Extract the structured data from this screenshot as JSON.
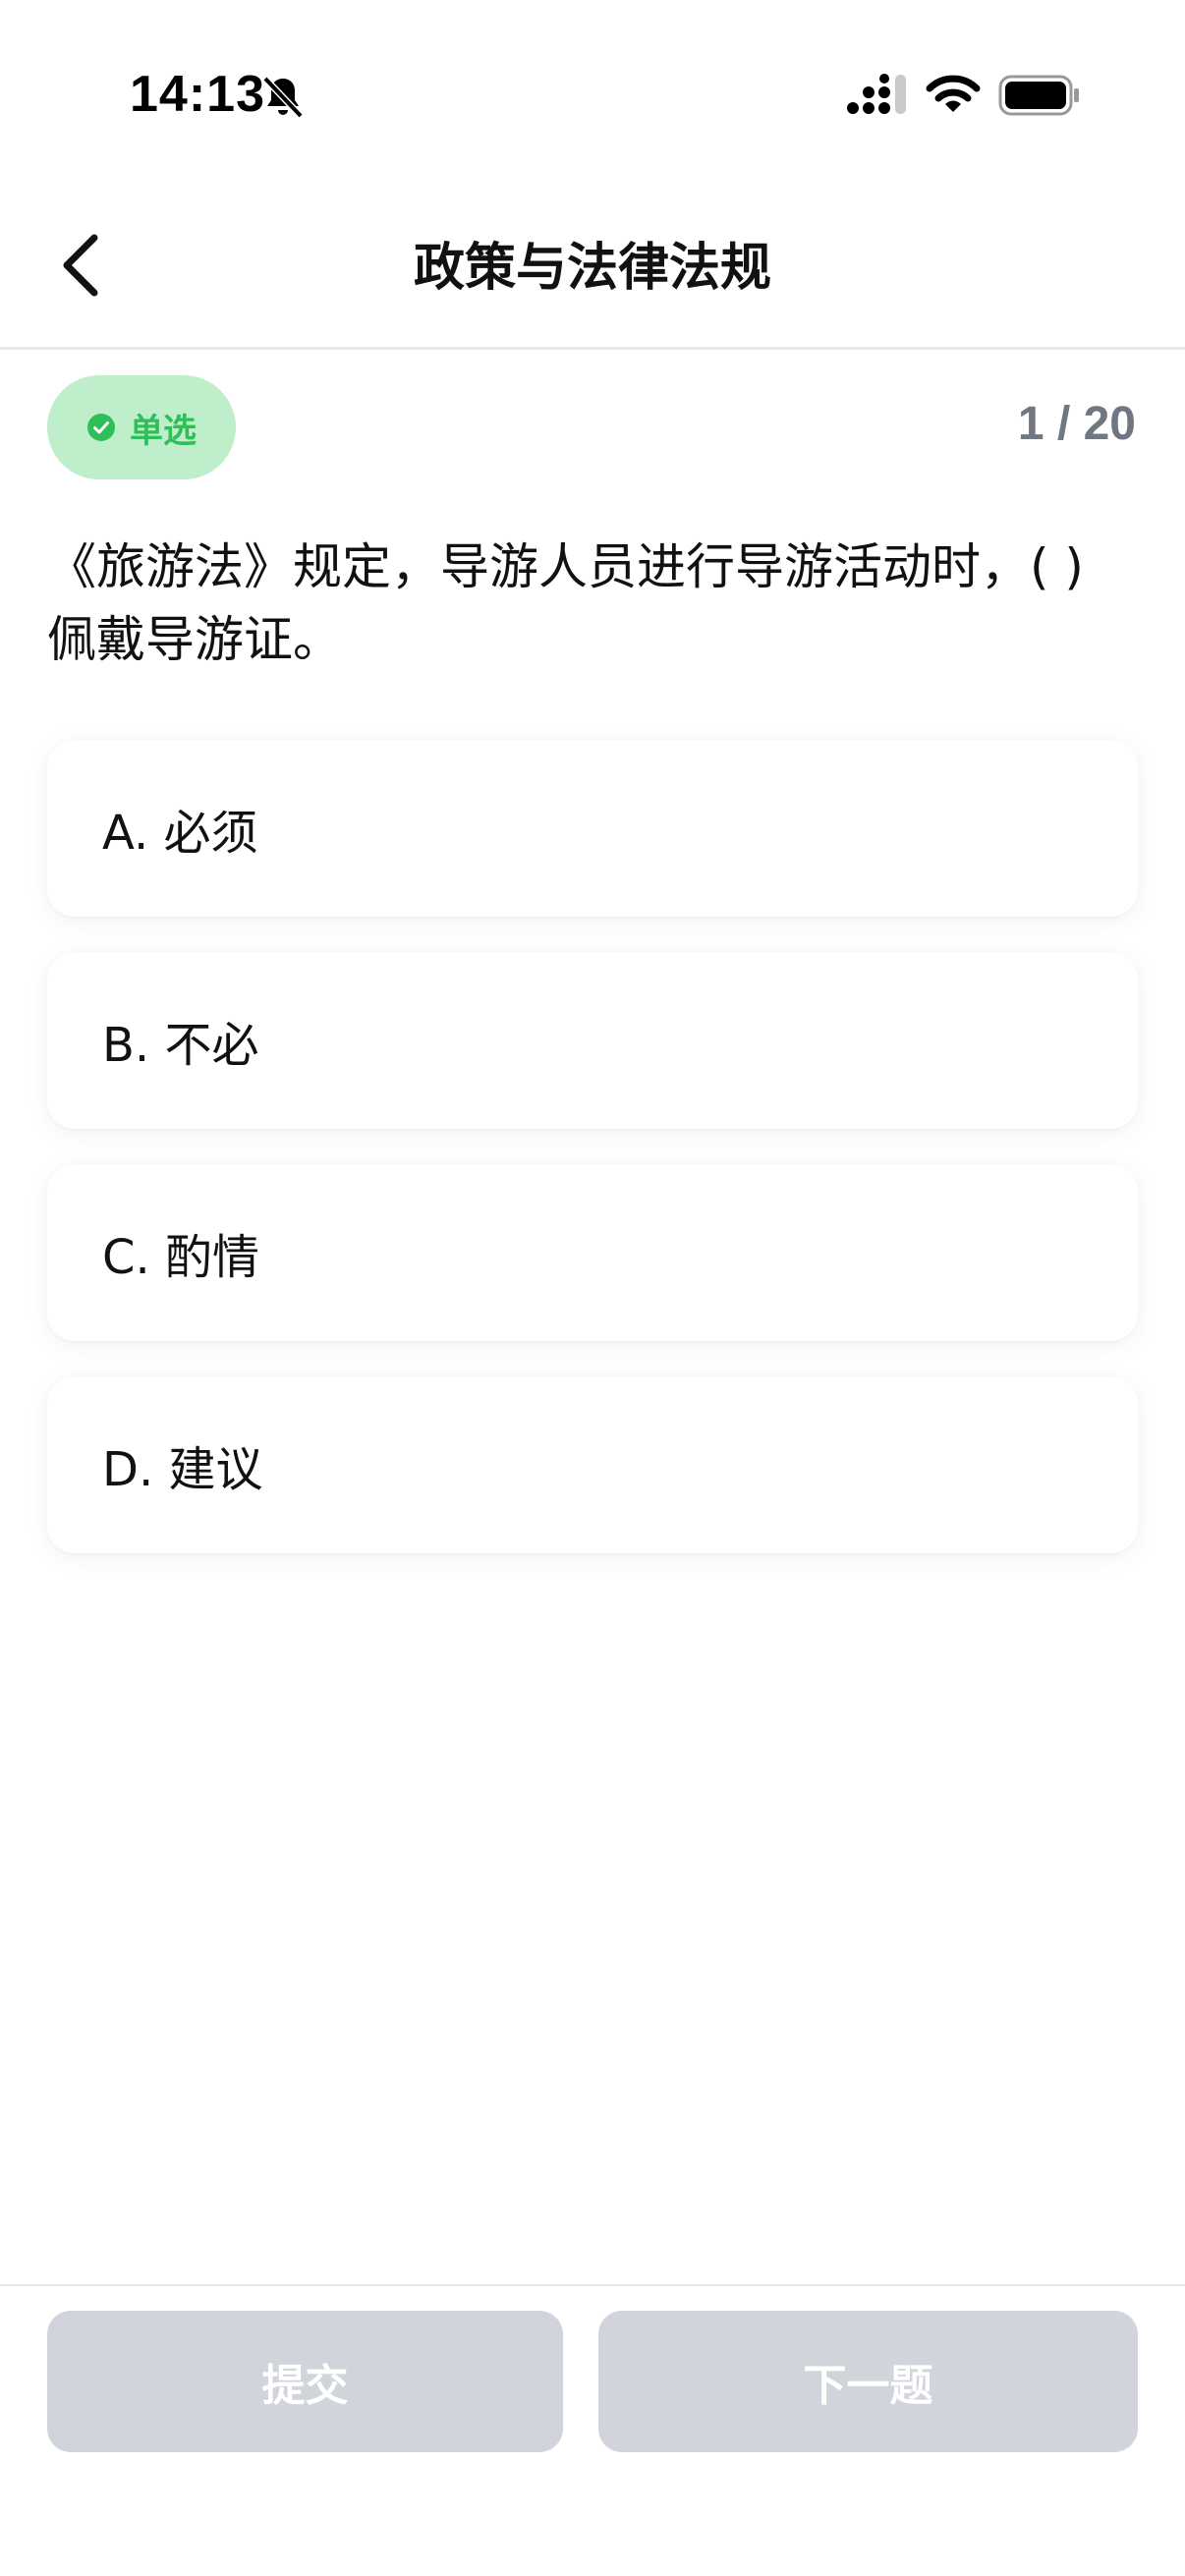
{
  "status_bar": {
    "time": "14:13",
    "icons": [
      "bell-slash-icon",
      "cellular-signal-icon",
      "wifi-icon",
      "battery-icon"
    ]
  },
  "nav": {
    "title": "政策与法律法规",
    "back_icon": "chevron-left-icon"
  },
  "question": {
    "type_label": "单选",
    "progress": "1 / 20",
    "text": "《旅游法》规定，导游人员进行导游活动时，( ) 佩戴导游证。",
    "options": [
      {
        "label": "A. 必须"
      },
      {
        "label": "B. 不必"
      },
      {
        "label": "C. 酌情"
      },
      {
        "label": "D. 建议"
      }
    ]
  },
  "actions": {
    "submit_label": "提交",
    "next_label": "下一题"
  },
  "colors": {
    "badge_bg": "#bfeecb",
    "badge_text": "#2fbf5a",
    "button_disabled": "#d1d5db",
    "progress_text": "#6f7782"
  }
}
